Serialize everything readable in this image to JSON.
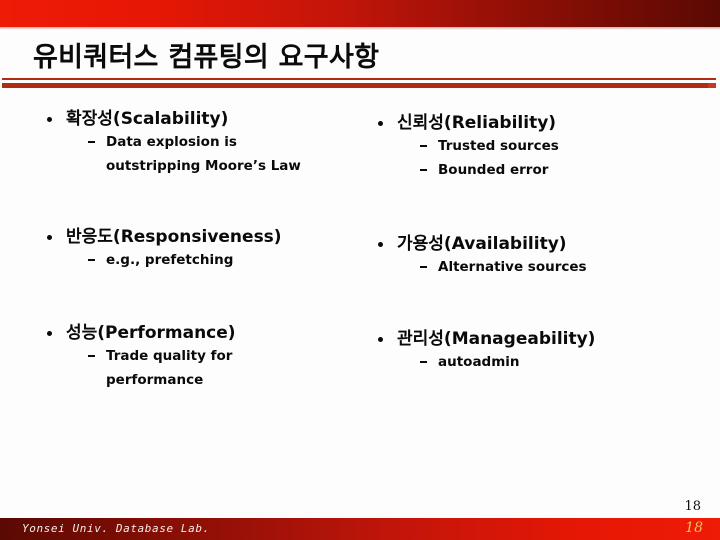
{
  "slide": {
    "title": "유비쿼터스 컴퓨팅의 요구사항",
    "page_number": "18"
  },
  "theme": {
    "band_red_bright": "#ee1b06",
    "band_red_dark": "#5a0903",
    "rule_red": "#b02a14",
    "text_black": "#0a0a0a",
    "footer_text_color": "#f4efe6",
    "footer_page_color": "#e8c45a"
  },
  "columns": {
    "left": [
      {
        "heading": "확장성(Scalability)",
        "sub": [
          {
            "line1": "Data explosion is",
            "line2": "outstripping Moore’s Law"
          }
        ]
      },
      {
        "heading": "반응도(Responsiveness)",
        "sub": [
          {
            "line1": "e.g., prefetching",
            "line2": ""
          }
        ]
      },
      {
        "heading": "성능(Performance)",
        "sub": [
          {
            "line1": "Trade quality for",
            "line2": "performance"
          }
        ]
      }
    ],
    "right": [
      {
        "heading": "신뢰성(Reliability)",
        "sub": [
          {
            "line1": "Trusted sources",
            "line2": ""
          },
          {
            "line1": "Bounded error",
            "line2": ""
          }
        ]
      },
      {
        "heading": "가용성(Availability)",
        "sub": [
          {
            "line1": "Alternative sources",
            "line2": ""
          }
        ]
      },
      {
        "heading": "관리성(Manageability)",
        "sub": [
          {
            "line1": "autoadmin",
            "line2": ""
          }
        ]
      }
    ]
  },
  "footer": {
    "lab_text": "Yonsei Univ. Database Lab.",
    "page_number": "18"
  }
}
